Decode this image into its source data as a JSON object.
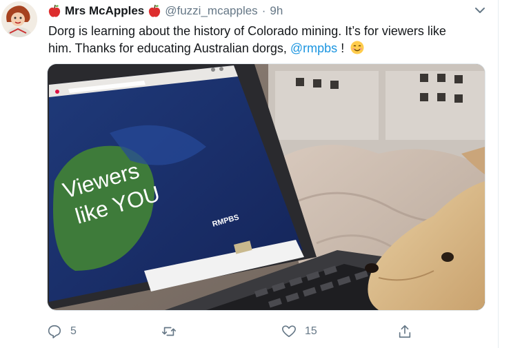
{
  "tweet": {
    "display_name": "Mrs McApples",
    "handle": "@fuzzi_mcapples",
    "separator": "·",
    "time": "9h",
    "text_line1": "Dorg is learning about the history of Colorado mining. It’s for viewers like",
    "text_line2_prefix": "him. Thanks for educating Australian dorgs,",
    "mention": "@rmpbs",
    "text_suffix": "!",
    "reply_count": "5",
    "retweet_count": "",
    "like_count": "15"
  },
  "media": {
    "screen_title_line1": "Viewers",
    "screen_title_line2": "like YOU",
    "screen_logo": "RMPBS"
  },
  "icons": {
    "apple": "red-apple-emoji",
    "emoji": "smiling-face-emoji",
    "caret": "chevron-down-icon",
    "reply": "reply-icon",
    "retweet": "retweet-icon",
    "like": "heart-icon",
    "share": "share-icon"
  },
  "colors": {
    "link": "#1b95e0",
    "muted": "#657786",
    "text": "#14171a"
  }
}
